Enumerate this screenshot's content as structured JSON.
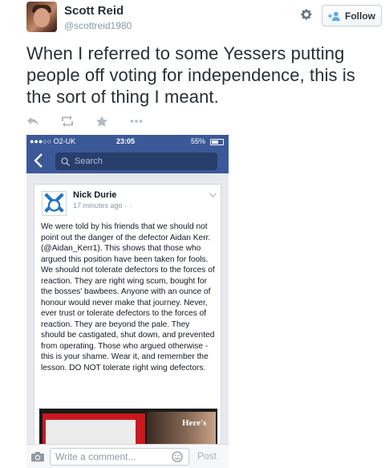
{
  "tweet": {
    "user_name": "Scott Reid",
    "user_handle": "@scottreid1980",
    "follow_label": "Follow",
    "text": "When I referred to some Yessers putting people off voting for independence, this is the sort of thing I meant.",
    "actions": [
      "reply-icon",
      "retweet-icon",
      "favorite-icon",
      "more-icon"
    ]
  },
  "phone": {
    "status": {
      "carrier": "●●●○○ O2-UK",
      "time": "23:05",
      "battery": "55%"
    },
    "search_placeholder": "Search",
    "post": {
      "author": "Nick Durie",
      "time": "17 minutes ago · ◌",
      "body": "We were told by his friends that we should not point out the danger of the defector Aidan Kerr. (@Aidan_Kerr1). This shows that those who argued this position have been taken for fools. We should not tolerate defectors to the forces of reaction. They are right wing scum, bought for the bosses' bawbees. Anyone with an ounce of honour would never make that journey. Never, ever trust or tolerate defectors to the forces of reaction. They are beyond the pale. They should be castigated, shut down, and prevented from operating. Those who argued otherwise - this is your shame. Wear it, and remember the lesson. DO NOT tolerate right wing defectors.",
      "image_caption": "Here's"
    },
    "comment_placeholder": "Write a comment...",
    "post_label": "Post"
  },
  "colors": {
    "facebook_blue": "#3b5998",
    "text": "#292f33",
    "muted": "#8899a6"
  }
}
